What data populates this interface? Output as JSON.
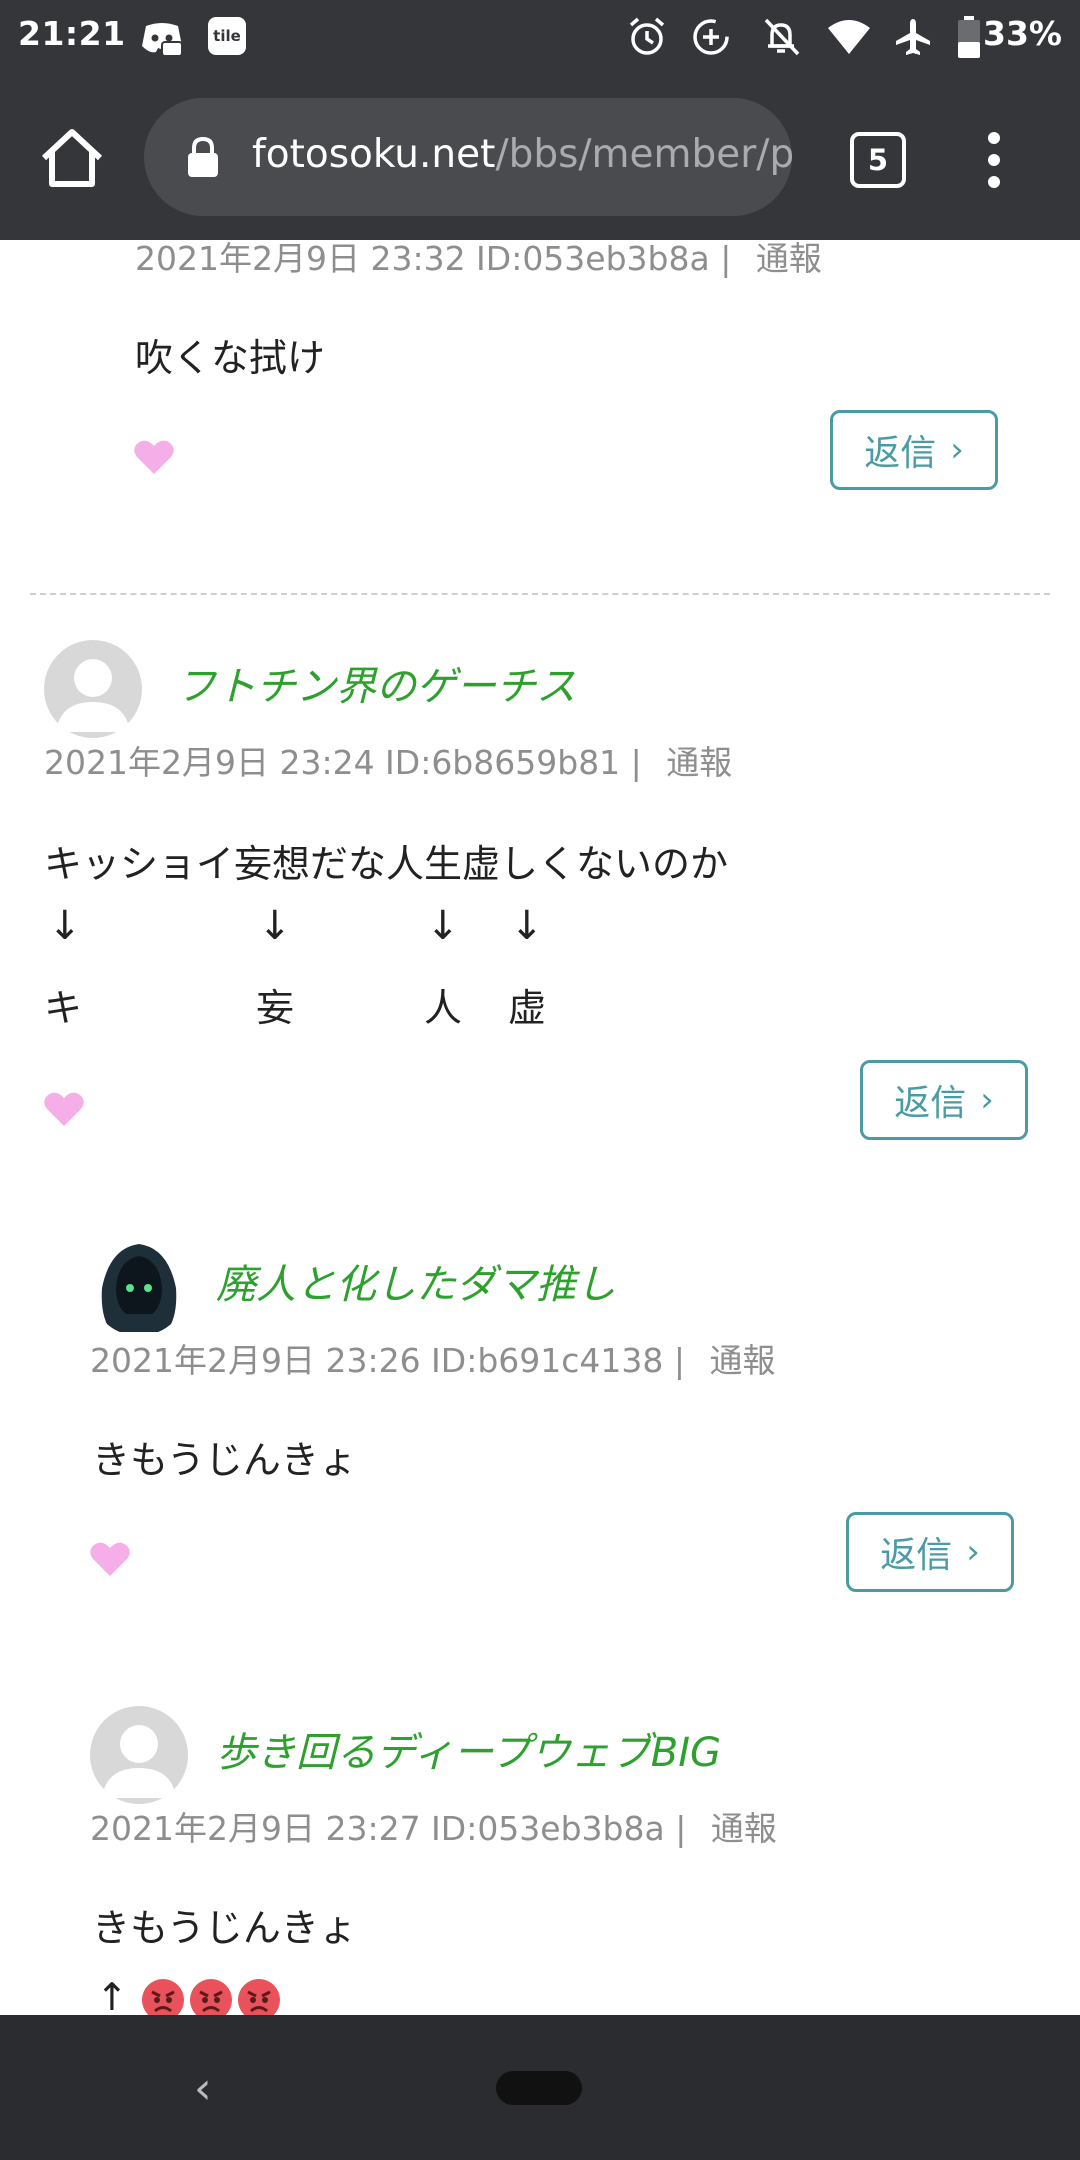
{
  "status_bar": {
    "time": "21:21",
    "notification_icons": [
      "discord-icon",
      "tile-icon"
    ],
    "system_icons": [
      "alarm-icon",
      "data-saver-icon",
      "notifications-off-icon",
      "wifi-icon",
      "airplane-icon",
      "battery-icon"
    ],
    "tile_label": "tile",
    "battery": "33%"
  },
  "browser": {
    "url_domain": "fotosoku.net",
    "url_path": "/bbs/member/p",
    "tab_count": "5",
    "theme_color": "#35363a"
  },
  "comments": [
    {
      "meta": "2021年2月9日 23:32 ID:053eb3b8a |",
      "report": "通報",
      "lines": [
        "吹くな拭け"
      ],
      "reply_label": "返信"
    },
    {
      "username": "フトチン界のゲーチス",
      "meta": "2021年2月9日 23:24 ID:6b8659b81 |",
      "report": "通報",
      "lines": [
        "キッショイ妄想だな人生虚しくないのか"
      ],
      "arrows": [
        "↓",
        "↓",
        "↓",
        "↓"
      ],
      "chars": [
        "キ",
        "妄",
        "人",
        "虚"
      ],
      "reply_label": "返信"
    },
    {
      "username": "廃人と化したダマ推し",
      "meta": "2021年2月9日 23:26 ID:b691c4138 |",
      "report": "通報",
      "lines": [
        "きもうじんきょ"
      ],
      "reply_label": "返信"
    },
    {
      "username": "歩き回るディープウェブBIG",
      "meta": "2021年2月9日 23:27 ID:053eb3b8a |",
      "report": "通報",
      "lines": [
        "きもうじんきょ"
      ],
      "arrow_up": "↑",
      "emojis": [
        "angry-face-icon",
        "angry-face-icon",
        "angry-face-icon"
      ]
    }
  ],
  "colors": {
    "username": "#2ea02e",
    "reply_border": "#4a9ba4",
    "heart": "#f5aee8",
    "meta": "#8e8e8e"
  }
}
